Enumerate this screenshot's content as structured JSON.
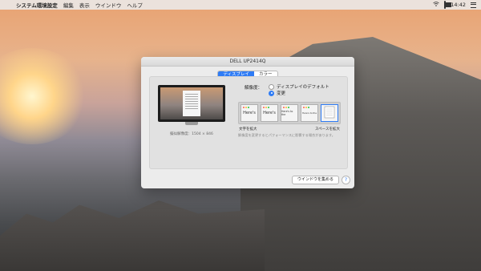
{
  "menubar": {
    "app_name": "システム環境設定",
    "items": [
      "編集",
      "表示",
      "ウインドウ",
      "ヘルプ"
    ],
    "time": "14:42",
    "battery_level": 0.8
  },
  "window": {
    "title": "DELL UP2414Q",
    "tabs": [
      {
        "label": "ディスプレイ",
        "active": true
      },
      {
        "label": "カラー",
        "active": false
      }
    ],
    "resolution_label": "解像度：",
    "options": [
      {
        "label": "ディスプレイのデフォルト",
        "selected": false
      },
      {
        "label": "変更",
        "selected": true
      }
    ],
    "thumbnails": [
      {
        "text": "Here's",
        "selected": false
      },
      {
        "text": "Here's",
        "selected": false
      },
      {
        "text": "Here's to the",
        "selected": false
      },
      {
        "text": "Here's to the",
        "selected": false
      },
      {
        "text": "",
        "selected": true
      }
    ],
    "left_caption": "文字を拡大",
    "right_caption": "スペースを拡大",
    "hint": "解像度を変更するとパフォーマンスに影響する場合があります。",
    "resolution_note": "擬似解像度：1504 × 846",
    "gather_button": "ウインドウを集める",
    "help_glyph": "?"
  },
  "colors": {
    "accent": "#2f7cf5"
  }
}
